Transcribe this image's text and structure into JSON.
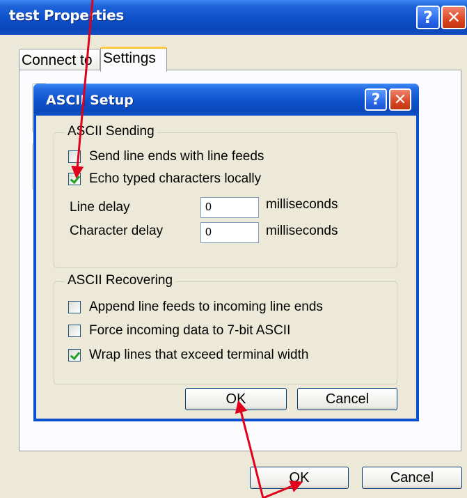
{
  "outer_window": {
    "title": "test Properties",
    "help_glyph": "?",
    "close_glyph": "✕",
    "tabs": [
      {
        "label": "Connect to",
        "active": false
      },
      {
        "label": "Settings",
        "active": true
      }
    ],
    "ok_label": "OK",
    "cancel_label": "Cancel"
  },
  "dialog": {
    "title": "ASCII Setup",
    "help_glyph": "?",
    "close_glyph": "✕",
    "sending": {
      "legend": "ASCII Sending",
      "send_line_ends": {
        "label": "Send line ends with line feeds",
        "checked": false
      },
      "echo_typed": {
        "label": "Echo typed characters locally",
        "checked": true
      },
      "line_delay": {
        "label": "Line delay",
        "value": "0",
        "unit": "milliseconds"
      },
      "char_delay": {
        "label": "Character delay",
        "value": "0",
        "unit": "milliseconds"
      }
    },
    "recovering": {
      "legend": "ASCII Recovering",
      "append_line_feeds": {
        "label": "Append line feeds to incoming line ends",
        "checked": false
      },
      "force_7bit": {
        "label": "Force incoming data to 7-bit ASCII",
        "checked": false
      },
      "wrap_lines": {
        "label": "Wrap lines that exceed terminal width",
        "checked": true
      }
    },
    "ok_label": "OK",
    "cancel_label": "Cancel"
  },
  "colors": {
    "annotation_arrow": "#e0001b",
    "title_bar": "#0a4fd0",
    "dialog_face": "#ece9d8"
  },
  "icons": [
    "help-icon",
    "close-icon",
    "checkbox-checked-icon",
    "checkbox-unchecked-icon",
    "annotation-arrow"
  ]
}
